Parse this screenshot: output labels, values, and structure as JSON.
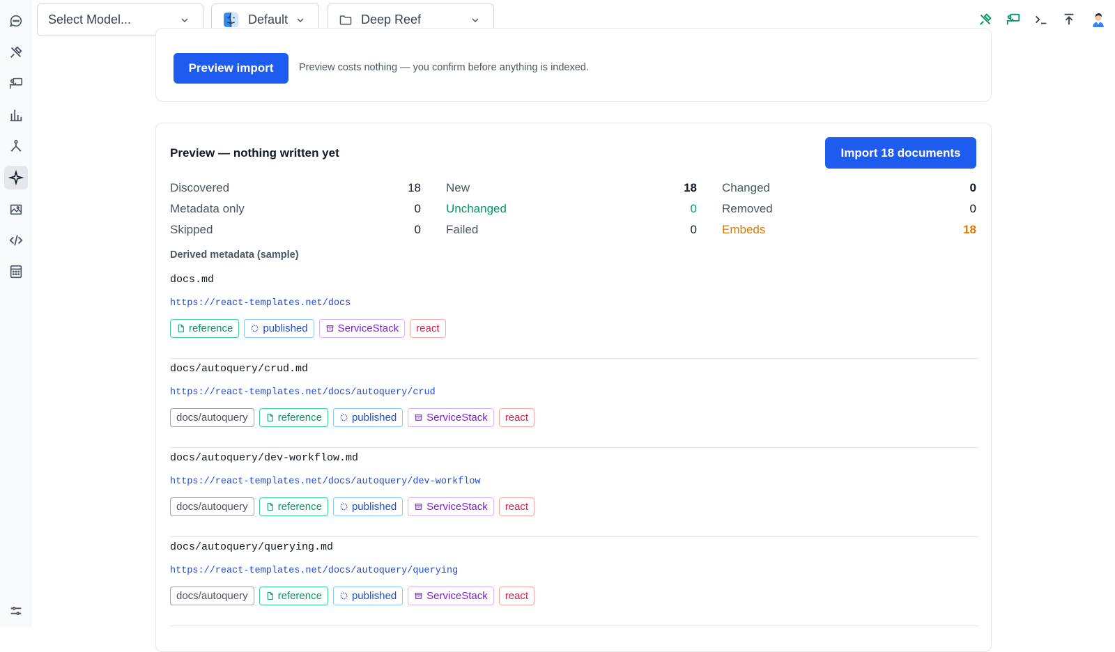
{
  "toolbar": {
    "model_select": {
      "value": "Select Model..."
    },
    "profile_select": {
      "value": "Default"
    },
    "project_select": {
      "value": "Deep Reef"
    },
    "icons": [
      "tools-icon",
      "presentation-icon",
      "terminal-icon",
      "upload-icon",
      "avatar"
    ]
  },
  "sidebar": {
    "items": [
      {
        "name": "chat-icon"
      },
      {
        "name": "tools-icon"
      },
      {
        "name": "presentation-icon"
      },
      {
        "name": "analytics-icon"
      },
      {
        "name": "pipeline-icon"
      },
      {
        "name": "sparkle-icon",
        "active": true
      },
      {
        "name": "gallery-icon"
      },
      {
        "name": "code-icon"
      },
      {
        "name": "calculator-icon"
      },
      {
        "name": "settings-sliders-icon"
      }
    ]
  },
  "import_card": {
    "preview_button": "Preview import",
    "hint": "Preview costs nothing — you confirm before anything is indexed."
  },
  "preview": {
    "title": "Preview — nothing written yet",
    "import_button": "Import 18 documents",
    "stats": [
      {
        "label": "Discovered",
        "value": "18"
      },
      {
        "label": "New",
        "value": "18"
      },
      {
        "label": "Changed",
        "value": "0"
      },
      {
        "label": "Metadata only",
        "value": "0"
      },
      {
        "label": "Unchanged",
        "value": "0"
      },
      {
        "label": "Removed",
        "value": "0"
      },
      {
        "label": "Skipped",
        "value": "0"
      },
      {
        "label": "Failed",
        "value": "0"
      },
      {
        "label": "Embeds",
        "value": "18"
      }
    ],
    "derived_heading": "Derived metadata (sample)",
    "documents": [
      {
        "path": "docs.md",
        "url": "https://react-templates.net/docs",
        "tags": [
          "reference",
          "published",
          "ServiceStack",
          "react"
        ]
      },
      {
        "path": "docs/autoquery/crud.md",
        "url": "https://react-templates.net/docs/autoquery/crud",
        "tags": [
          "docs/autoquery",
          "reference",
          "published",
          "ServiceStack",
          "react"
        ]
      },
      {
        "path": "docs/autoquery/dev-workflow.md",
        "url": "https://react-templates.net/docs/autoquery/dev-workflow",
        "tags": [
          "docs/autoquery",
          "reference",
          "published",
          "ServiceStack",
          "react"
        ]
      },
      {
        "path": "docs/autoquery/querying.md",
        "url": "https://react-templates.net/docs/autoquery/querying",
        "tags": [
          "docs/autoquery",
          "reference",
          "published",
          "ServiceStack",
          "react"
        ]
      }
    ]
  },
  "colors": {
    "accent": "#1e5cf0",
    "green": "#059669",
    "orange": "#d97706"
  }
}
